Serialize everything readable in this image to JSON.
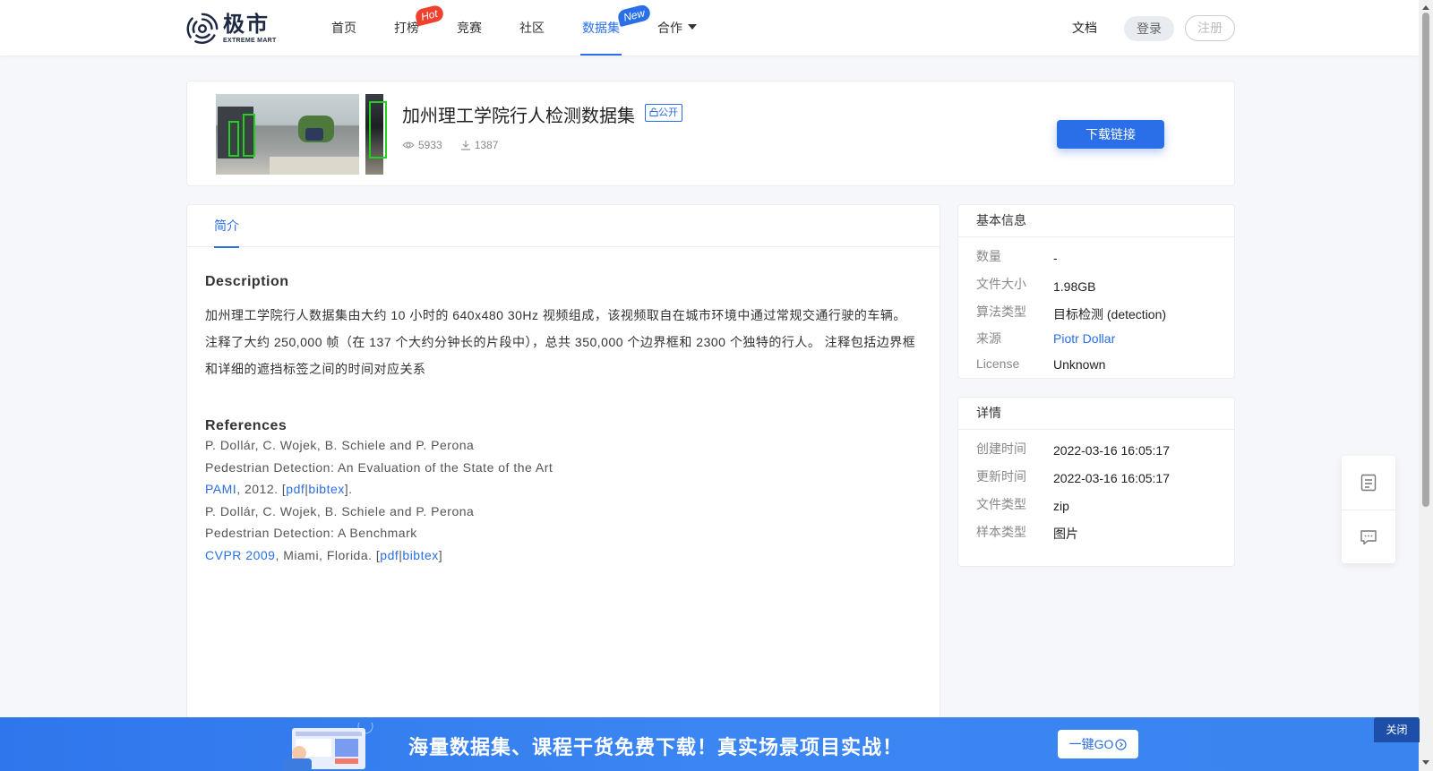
{
  "header": {
    "logo_cn": "极市",
    "logo_en": "EXTREME MART",
    "nav": [
      {
        "label": "首页"
      },
      {
        "label": "打榜",
        "badge": "Hot"
      },
      {
        "label": "竞赛"
      },
      {
        "label": "社区"
      },
      {
        "label": "数据集",
        "badge": "New",
        "active": true
      },
      {
        "label": "合作"
      }
    ],
    "docs": "文档",
    "login": "登录",
    "register": "注册"
  },
  "dataset": {
    "title": "加州理工学院行人检测数据集",
    "visibility": "公开",
    "views": "5933",
    "downloads": "1387",
    "download_button": "下载链接"
  },
  "tabs": {
    "intro": "简介"
  },
  "description": {
    "heading": "Description",
    "text": "加州理工学院行人数据集由大约 10 小时的 640x480 30Hz 视频组成，该视频取自在城市环境中通过常规交通行驶的车辆。 注释了大约 250,000 帧（在 137 个大约分钟长的片段中），总共 350,000 个边界框和 2300 个独特的行人。 注释包括边界框和详细的遮挡标签之间的时间对应关系"
  },
  "references": {
    "heading": "References",
    "r1_authors": "P. Dollár, C. Wojek, B. Schiele and P. Perona",
    "r1_title": "Pedestrian Detection: An Evaluation of the State of the Art",
    "r1_venue": "PAMI",
    "r1_year": ", 2012. [",
    "r1_pdf": "pdf",
    "r1_sep": "|",
    "r1_bibtex": "bibtex",
    "r1_end": "].",
    "r2_authors": "P. Dollár, C. Wojek, B. Schiele and P. Perona",
    "r2_title": "Pedestrian Detection: A Benchmark",
    "r2_venue": "CVPR 2009",
    "r2_place": ", Miami, Florida. [",
    "r2_pdf": "pdf",
    "r2_sep": "|",
    "r2_bibtex": "bibtex",
    "r2_end": "]"
  },
  "basic_info": {
    "title": "基本信息",
    "rows": [
      {
        "k": "数量",
        "v": "-"
      },
      {
        "k": "文件大小",
        "v": "1.98GB"
      },
      {
        "k": "算法类型",
        "v": "目标检测 (detection)"
      },
      {
        "k": "来源",
        "v": "Piotr Dollar"
      },
      {
        "k": "License",
        "v": "Unknown"
      }
    ]
  },
  "details": {
    "title": "详情",
    "rows": [
      {
        "k": "创建时间",
        "v": "2022-03-16 16:05:17"
      },
      {
        "k": "更新时间",
        "v": "2022-03-16 16:05:17"
      },
      {
        "k": "文件类型",
        "v": "zip"
      },
      {
        "k": "样本类型",
        "v": "图片"
      }
    ]
  },
  "banner": {
    "text": "海量数据集、课程干货免费下载！真实场景项目实战！",
    "go": "一键GO",
    "close": "关闭"
  },
  "colors": {
    "accent": "#2a6ee8",
    "hot": "#f0412f",
    "banner": "#3b86f2"
  }
}
